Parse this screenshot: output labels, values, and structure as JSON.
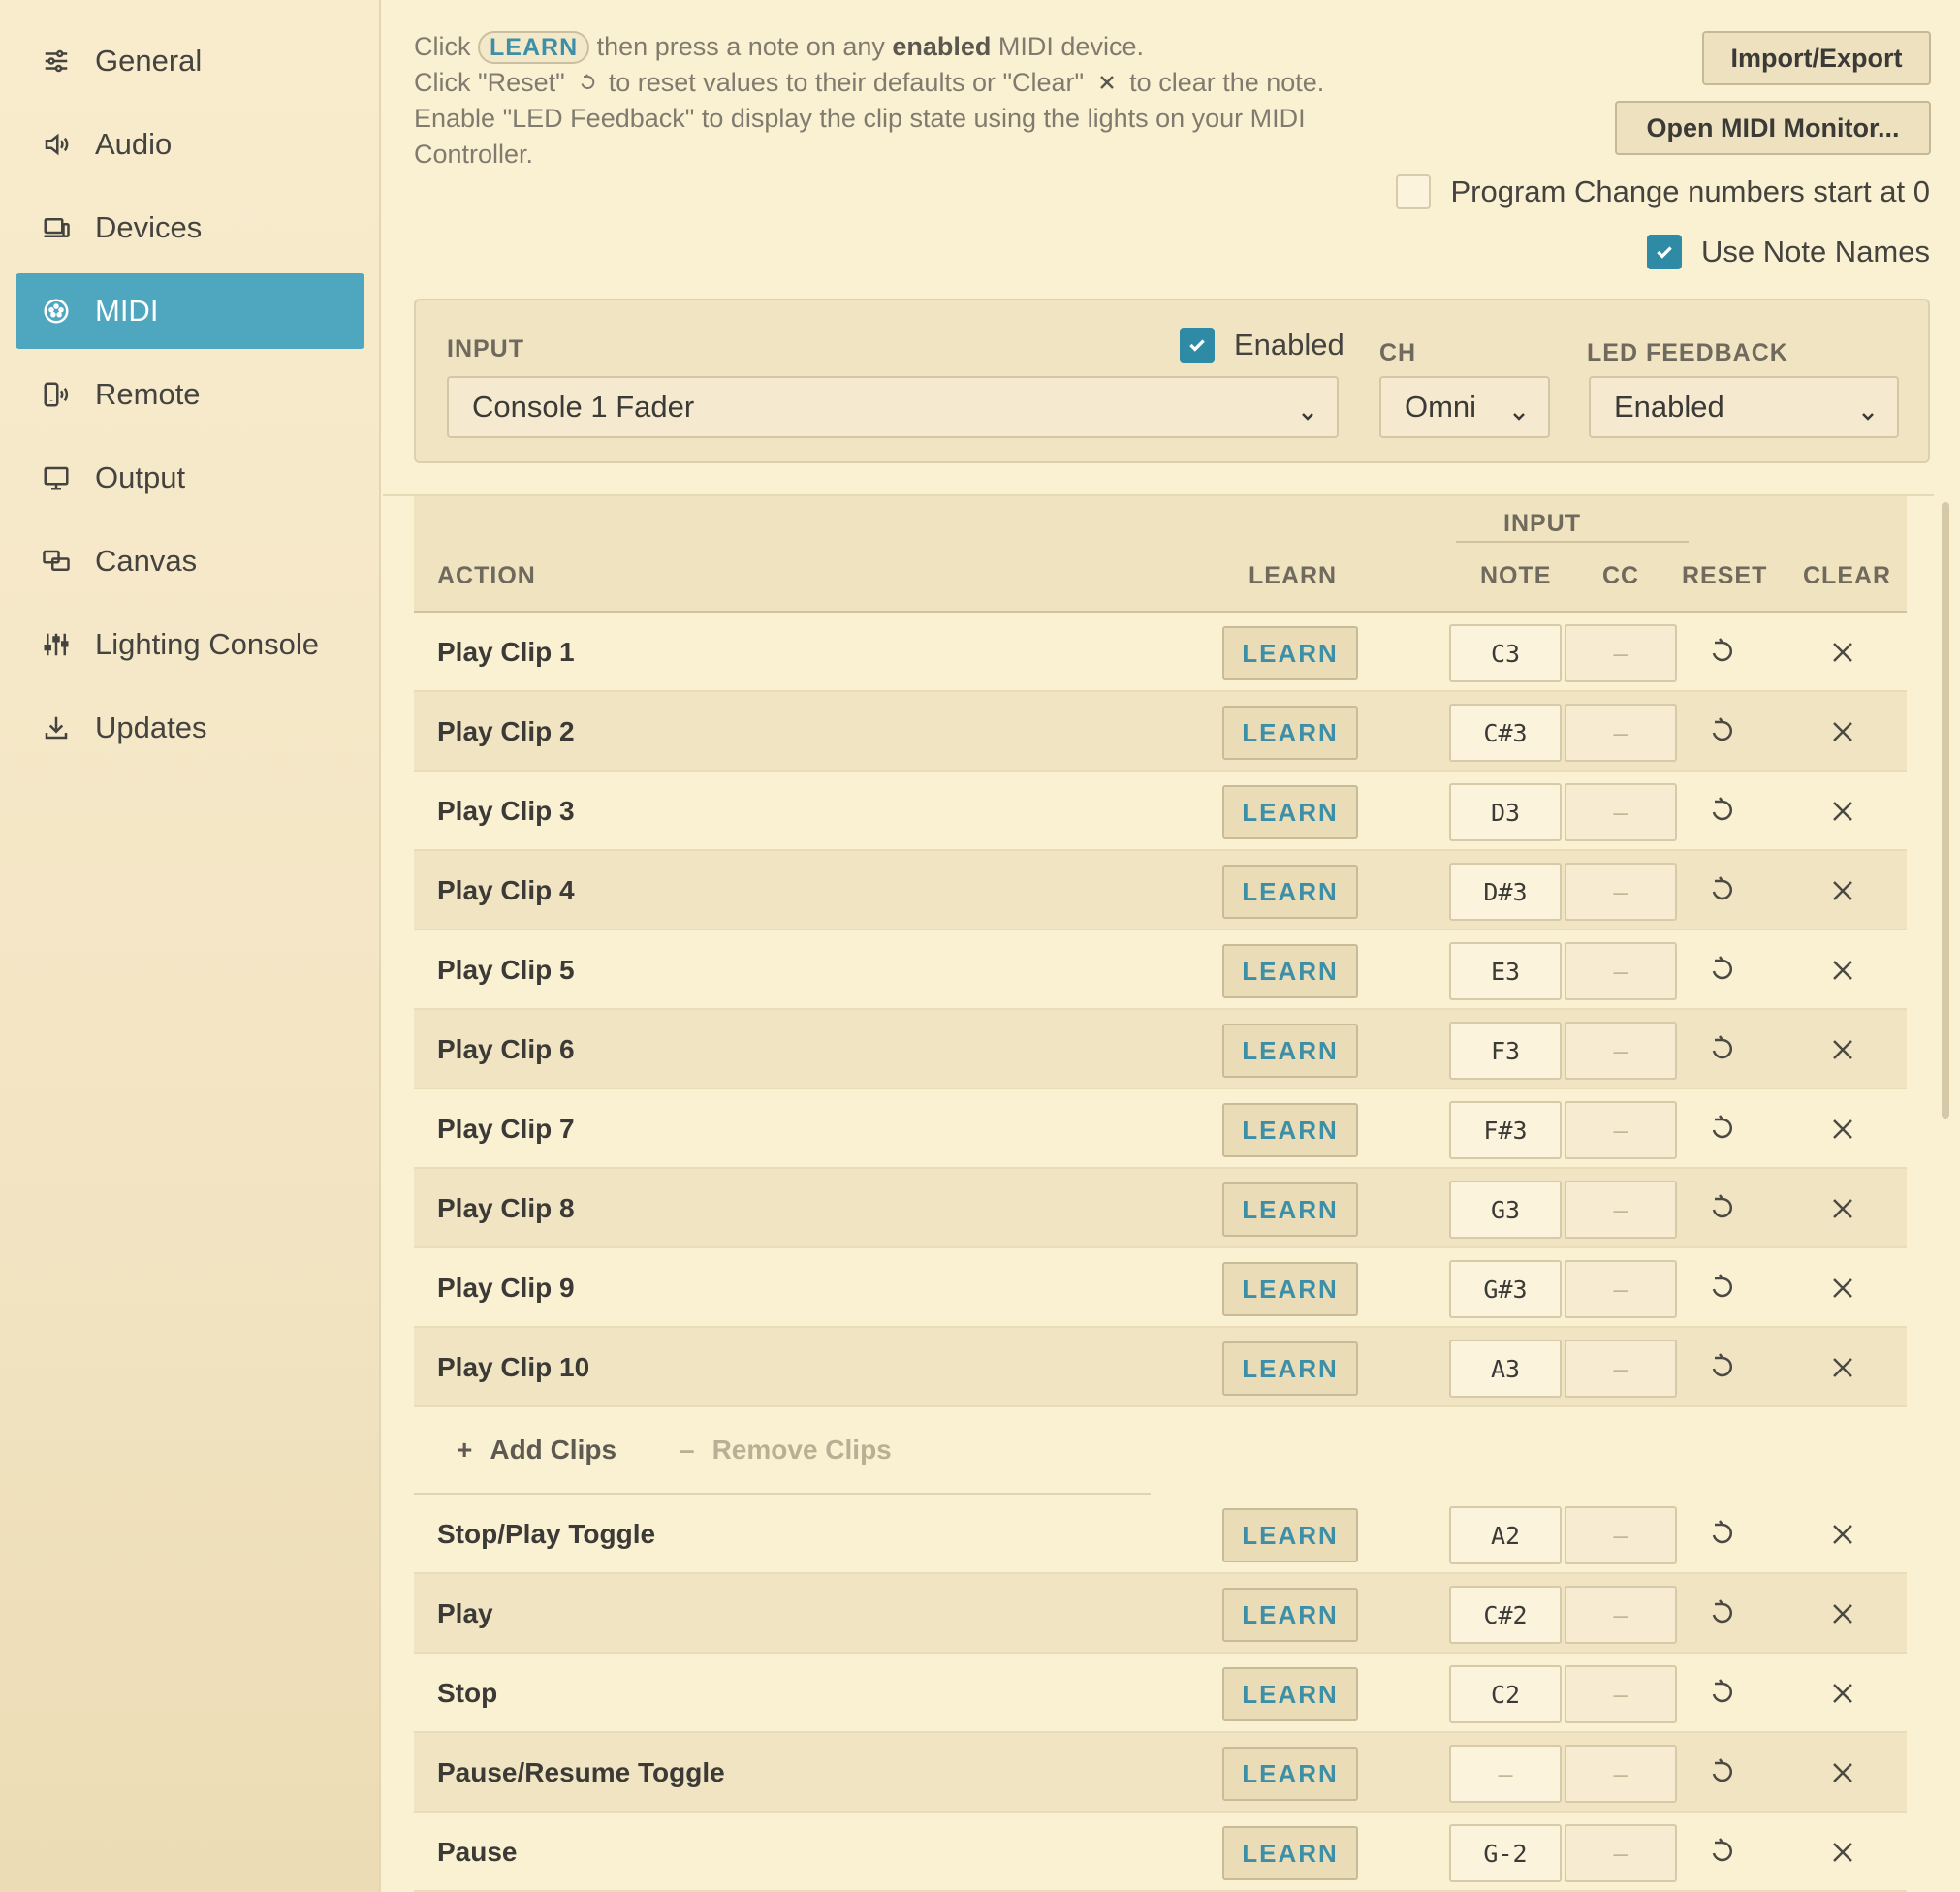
{
  "sidebar": {
    "items": [
      {
        "label": "General",
        "icon": "sliders-icon",
        "active": false
      },
      {
        "label": "Audio",
        "icon": "speaker-icon",
        "active": false
      },
      {
        "label": "Devices",
        "icon": "devices-icon",
        "active": false
      },
      {
        "label": "MIDI",
        "icon": "midi-icon",
        "active": true
      },
      {
        "label": "Remote",
        "icon": "remote-icon",
        "active": false
      },
      {
        "label": "Output",
        "icon": "monitor-icon",
        "active": false
      },
      {
        "label": "Canvas",
        "icon": "canvas-icon",
        "active": false
      },
      {
        "label": "Lighting Console",
        "icon": "faders-icon",
        "active": false
      },
      {
        "label": "Updates",
        "icon": "download-icon",
        "active": false
      }
    ]
  },
  "help": {
    "line1_pre": "Click",
    "learn_pill": "LEARN",
    "line1_mid": "then press a note on any",
    "line1_bold": "enabled",
    "line1_post": "MIDI device.",
    "line2_pre": "Click \"Reset\"",
    "line2_mid": "to reset values to their defaults or \"Clear\"",
    "line2_post": "to clear the note.",
    "line3": "Enable \"LED Feedback\" to display the clip state using the lights on your MIDI Controller."
  },
  "toolbar": {
    "import_export": "Import/Export",
    "open_monitor": "Open MIDI Monitor...",
    "program_change_label": "Program Change numbers start at 0",
    "program_change_checked": false,
    "note_names_label": "Use Note Names",
    "note_names_checked": true
  },
  "input_panel": {
    "input_label": "INPUT",
    "input_value": "Console 1 Fader",
    "enabled_label": "Enabled",
    "enabled_checked": true,
    "ch_label": "CH",
    "ch_value": "Omni",
    "led_label": "LED FEEDBACK",
    "led_value": "Enabled"
  },
  "table": {
    "group_header": "INPUT",
    "headers": {
      "action": "ACTION",
      "learn": "LEARN",
      "note": "NOTE",
      "cc": "CC",
      "reset": "RESET",
      "clear": "CLEAR"
    },
    "learn_label": "LEARN",
    "empty_value": "–",
    "clip_rows": [
      {
        "action": "Play Clip 1",
        "note": "C3",
        "cc": "–"
      },
      {
        "action": "Play Clip 2",
        "note": "C#3",
        "cc": "–"
      },
      {
        "action": "Play Clip 3",
        "note": "D3",
        "cc": "–"
      },
      {
        "action": "Play Clip 4",
        "note": "D#3",
        "cc": "–"
      },
      {
        "action": "Play Clip 5",
        "note": "E3",
        "cc": "–"
      },
      {
        "action": "Play Clip 6",
        "note": "F3",
        "cc": "–"
      },
      {
        "action": "Play Clip 7",
        "note": "F#3",
        "cc": "–"
      },
      {
        "action": "Play Clip 8",
        "note": "G3",
        "cc": "–"
      },
      {
        "action": "Play Clip 9",
        "note": "G#3",
        "cc": "–"
      },
      {
        "action": "Play Clip 10",
        "note": "A3",
        "cc": "–"
      }
    ],
    "add_clips": "Add Clips",
    "remove_clips": "Remove Clips",
    "transport_rows": [
      {
        "action": "Stop/Play Toggle",
        "note": "A2",
        "cc": "–"
      },
      {
        "action": "Play",
        "note": "C#2",
        "cc": "–"
      },
      {
        "action": "Stop",
        "note": "C2",
        "cc": "–"
      },
      {
        "action": "Pause/Resume Toggle",
        "note": "–",
        "cc": "–"
      },
      {
        "action": "Pause",
        "note": "G-2",
        "cc": "–"
      }
    ]
  },
  "colors": {
    "accent": "#4fa7bf",
    "learn_text": "#3c8fa6",
    "background": "#faf0d2"
  }
}
